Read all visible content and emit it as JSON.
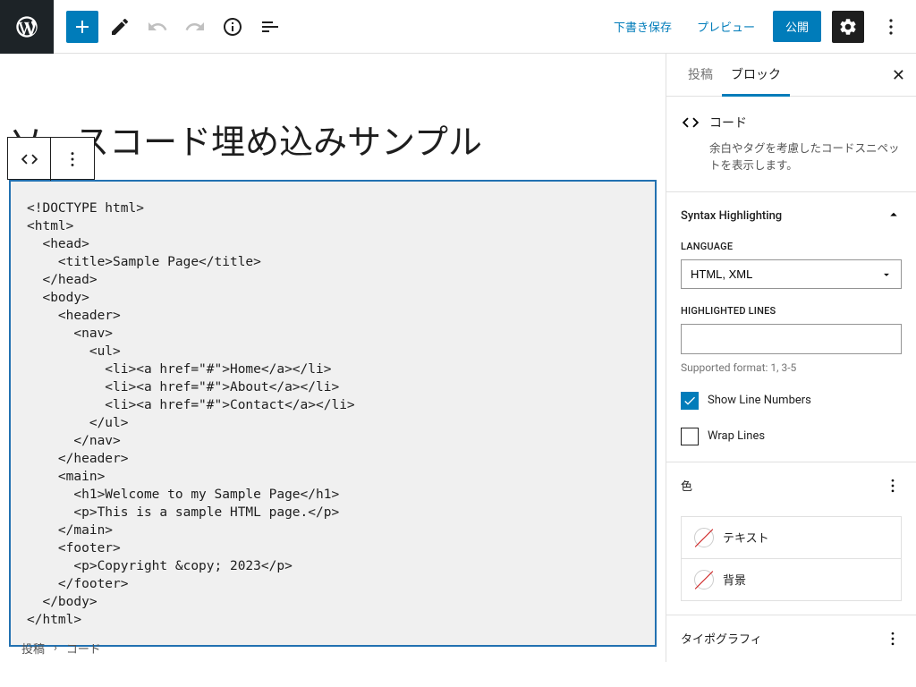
{
  "topbar": {
    "save_draft": "下書き保存",
    "preview": "プレビュー",
    "publish": "公開"
  },
  "page": {
    "title": "ソースコード埋め込みサンプル",
    "code": "<!DOCTYPE html>\n<html>\n  <head>\n    <title>Sample Page</title>\n  </head>\n  <body>\n    <header>\n      <nav>\n        <ul>\n          <li><a href=\"#\">Home</a></li>\n          <li><a href=\"#\">About</a></li>\n          <li><a href=\"#\">Contact</a></li>\n        </ul>\n      </nav>\n    </header>\n    <main>\n      <h1>Welcome to my Sample Page</h1>\n      <p>This is a sample HTML page.</p>\n    </main>\n    <footer>\n      <p>Copyright &copy; 2023</p>\n    </footer>\n  </body>\n</html>"
  },
  "sidebar": {
    "tabs": {
      "post": "投稿",
      "block": "ブロック"
    },
    "block_info": {
      "title": "コード",
      "desc": "余白やタグを考慮したコードスニペットを表示します。"
    },
    "syntax": {
      "title": "Syntax Highlighting",
      "language_label": "LANGUAGE",
      "language_value": "HTML, XML",
      "highlighted_label": "HIGHLIGHTED LINES",
      "highlighted_value": "",
      "hint": "Supported format: 1, 3-5",
      "show_line_numbers": "Show Line Numbers",
      "wrap_lines": "Wrap Lines"
    },
    "color": {
      "title": "色",
      "text": "テキスト",
      "background": "背景"
    },
    "typography": {
      "title": "タイポグラフィ"
    }
  },
  "breadcrumb": {
    "post": "投稿",
    "sep": "›",
    "code": "コード"
  }
}
